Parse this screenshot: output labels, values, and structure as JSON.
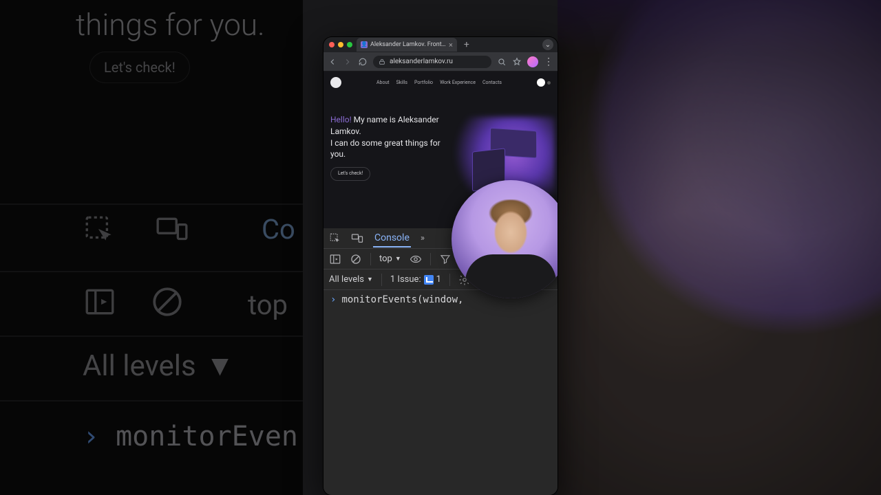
{
  "bg": {
    "text1": "things for you.",
    "check_btn": "Let's check!",
    "console_tab": "Co",
    "top_ctx": "top",
    "all_levels": "All levels",
    "monitor": "monitorEven"
  },
  "browser": {
    "tab_title": "Aleksander Lamkov. Frontend",
    "url": "aleksanderlamkov.ru"
  },
  "site": {
    "nav": {
      "about": "About",
      "skills": "Skills",
      "portfolio": "Portfolio",
      "work": "Work Experience",
      "contacts": "Contacts"
    },
    "hello": "Hello!",
    "line1": " My name is Aleksander Lamkov.",
    "line2": "I can do some great things for you.",
    "cta": "Let's check!"
  },
  "devtools": {
    "console_tab": "Console",
    "context": "top",
    "levels": "All levels",
    "issues_label": "1 Issue:",
    "issues_count": "1",
    "input": "monitorEvents(window,"
  }
}
